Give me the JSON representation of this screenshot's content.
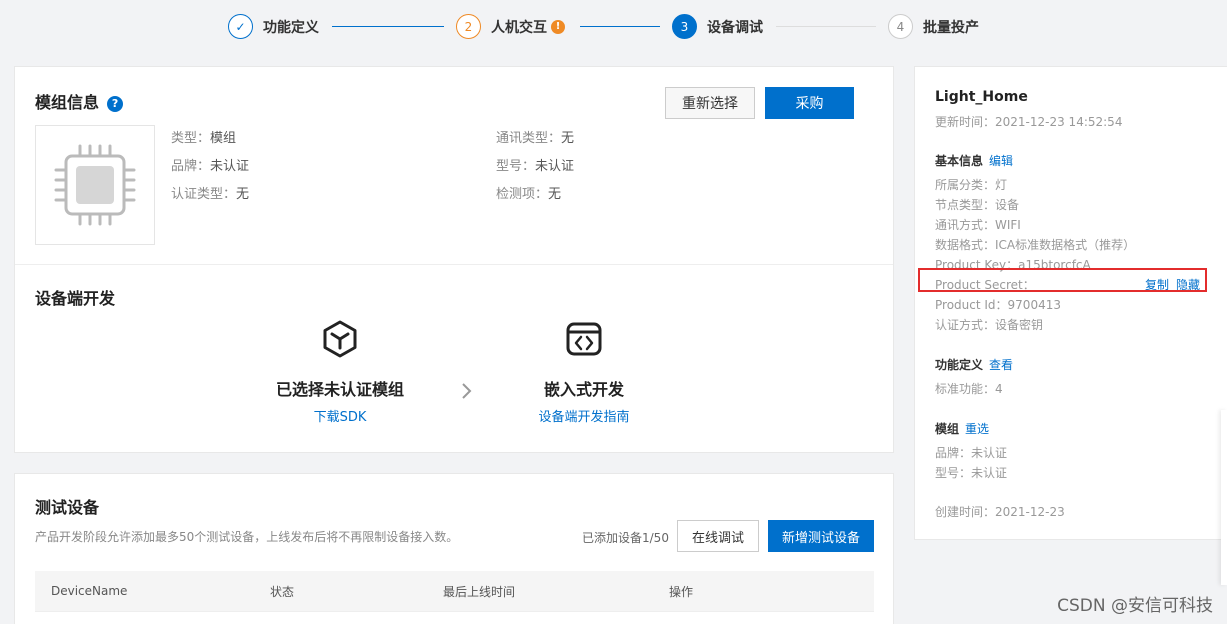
{
  "steps": [
    {
      "num": "✓",
      "label": "功能定义"
    },
    {
      "num": "2",
      "label": "人机交互",
      "badge": "!"
    },
    {
      "num": "3",
      "label": "设备调试"
    },
    {
      "num": "4",
      "label": "批量投产"
    }
  ],
  "module": {
    "title": "模组信息",
    "help": "?",
    "reselect": "重新选择",
    "purchase": "采购",
    "fields": {
      "type_k": "类型：",
      "type_v": "模组",
      "brand_k": "品牌：",
      "brand_v": "未认证",
      "cert_k": "认证类型：",
      "cert_v": "无",
      "comm_k": "通讯类型：",
      "comm_v": "无",
      "model_k": "型号：",
      "model_v": "未认证",
      "check_k": "检测项：",
      "check_v": "无"
    }
  },
  "devdev": {
    "title": "设备端开发",
    "item1_title": "已选择未认证模组",
    "item1_link": "下载SDK",
    "item2_title": "嵌入式开发",
    "item2_link": "设备端开发指南"
  },
  "testdev": {
    "title": "测试设备",
    "desc": "产品开发阶段允许添加最多50个测试设备，上线发布后将不再限制设备接入数。",
    "count": "已添加设备1/50",
    "online_debug": "在线调试",
    "add_device": "新增测试设备",
    "columns": [
      "DeviceName",
      "状态",
      "最后上线时间",
      "操作"
    ]
  },
  "right": {
    "product_name": "Light_Home",
    "updated": "更新时间：2021-12-23 14:52:54",
    "basic_title": "基本信息",
    "edit": "编辑",
    "category": "所属分类：灯",
    "node_type": "节点类型：设备",
    "comm": "通讯方式：WIFI",
    "data_format": "数据格式：ICA标准数据格式（推荐）",
    "product_key": "Product Key：a15btorcfcA",
    "product_secret": "Product Secret：",
    "copy": "复制",
    "hide": "隐藏",
    "product_id": "Product Id：9700413",
    "auth": "认证方式：设备密钥",
    "func_title": "功能定义",
    "view": "查看",
    "std_func": "标准功能：4",
    "module_title": "模组",
    "reselect": "重选",
    "brand": "品牌：未认证",
    "model": "型号：未认证",
    "created": "创建时间：2021-12-23"
  },
  "watermark": "CSDN @安信可科技"
}
